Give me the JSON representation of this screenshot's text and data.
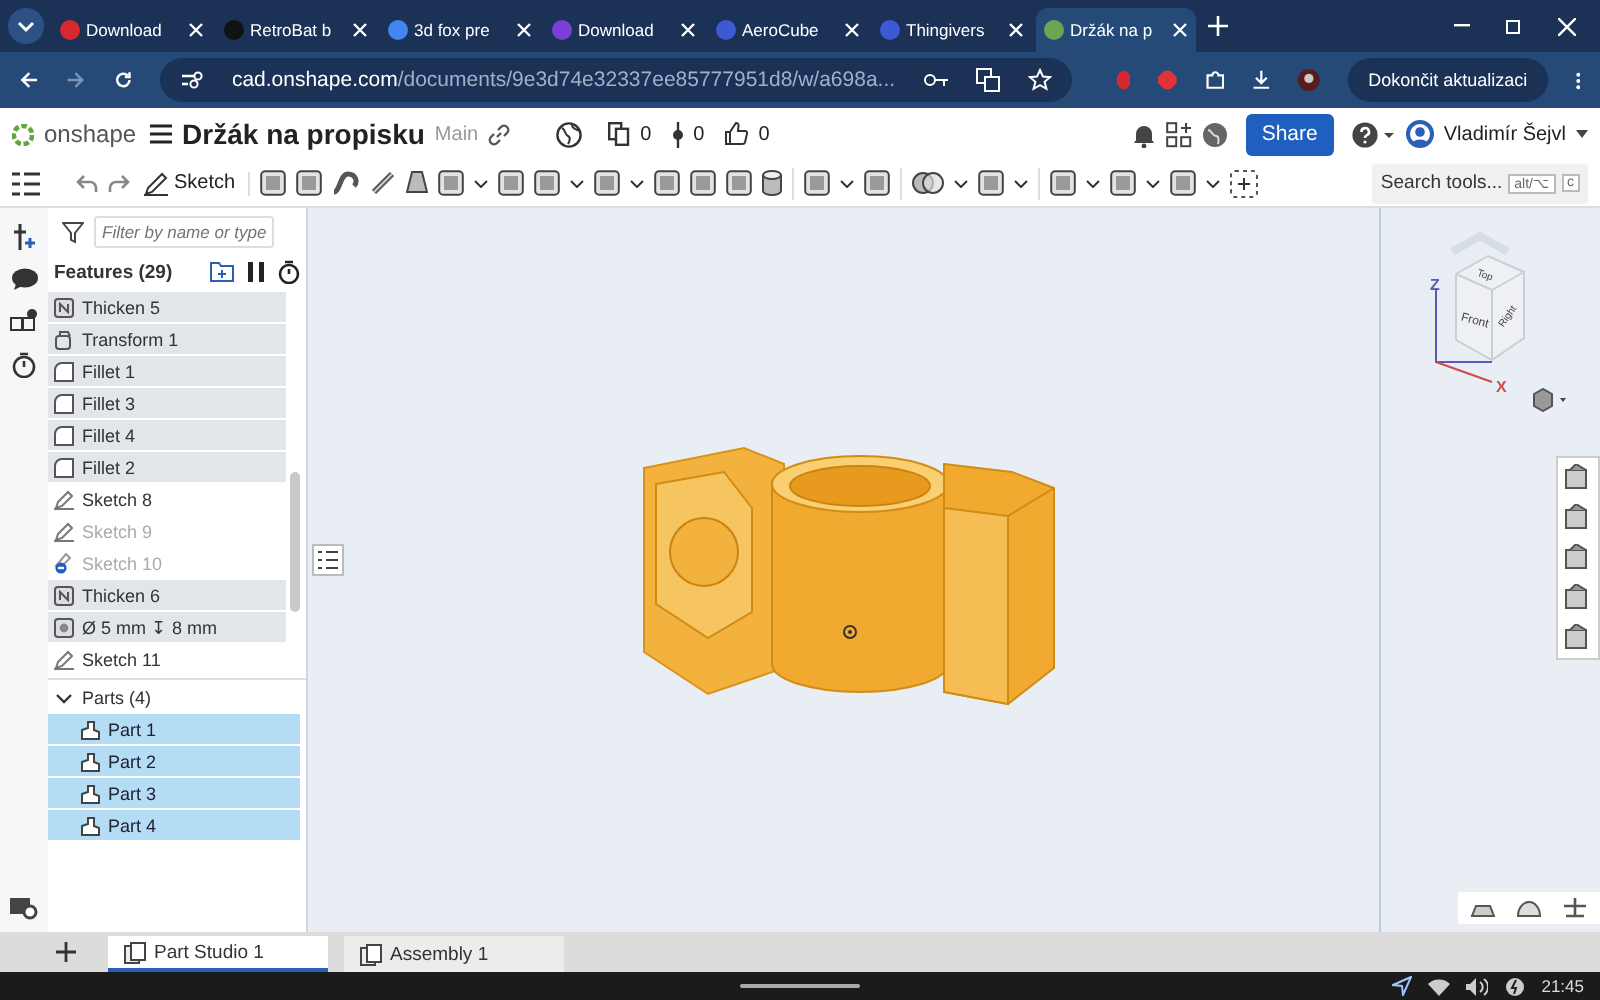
{
  "browser": {
    "tabs": [
      {
        "title": "Download",
        "selected": false,
        "color": "#d8282f"
      },
      {
        "title": "RetroBat b",
        "selected": false,
        "color": "#111111"
      },
      {
        "title": "3d fox pre",
        "selected": false,
        "color": "#4285f4"
      },
      {
        "title": "Download",
        "selected": false,
        "color": "#7b3fd6"
      },
      {
        "title": "AeroCube",
        "selected": false,
        "color": "#3c5ad6"
      },
      {
        "title": "Thingivers",
        "selected": false,
        "color": "#3c5ad6"
      },
      {
        "title": "Držák na p",
        "selected": true,
        "color": "#6aa84f"
      }
    ],
    "url_host": "cad.onshape.com",
    "url_path": "/documents/9e3d74e32337ee85777951d8/w/a698a...",
    "update_button": "Dokončit aktualizaci"
  },
  "header": {
    "brand": "onshape",
    "document_title": "Držák na propisku",
    "branch": "Main",
    "counts": [
      "0",
      "0",
      "0"
    ],
    "share": "Share",
    "user": "Vladimír Šejvl"
  },
  "toolbar": {
    "sketch": "Sketch",
    "search": "Search tools...",
    "shortcut": [
      "alt/⌥",
      "c"
    ]
  },
  "features": {
    "filter_placeholder": "Filter by name or type",
    "heading": "Features (29)",
    "items": [
      {
        "name": "Thicken 5",
        "kind": "thicken",
        "dimmed": false
      },
      {
        "name": "Transform 1",
        "kind": "transform",
        "dimmed": false
      },
      {
        "name": "Fillet 1",
        "kind": "fillet",
        "dimmed": false
      },
      {
        "name": "Fillet 3",
        "kind": "fillet",
        "dimmed": false
      },
      {
        "name": "Fillet 4",
        "kind": "fillet",
        "dimmed": false
      },
      {
        "name": "Fillet 2",
        "kind": "fillet",
        "dimmed": false
      },
      {
        "name": "Sketch 8",
        "kind": "sketch",
        "dimmed": false
      },
      {
        "name": "Sketch 9",
        "kind": "sketch",
        "dimmed": true
      },
      {
        "name": "Sketch 10",
        "kind": "sketch-flagged",
        "dimmed": true
      },
      {
        "name": "Thicken 6",
        "kind": "thicken",
        "dimmed": false
      },
      {
        "name": "Ø 5 mm ↧ 8 mm",
        "kind": "hole",
        "dimmed": false
      },
      {
        "name": "Sketch 11",
        "kind": "sketch",
        "dimmed": false
      }
    ],
    "parts_heading": "Parts (4)",
    "parts": [
      {
        "name": "Part 1",
        "selected": true
      },
      {
        "name": "Part 2",
        "selected": true
      },
      {
        "name": "Part 3",
        "selected": true
      },
      {
        "name": "Part 4",
        "selected": true
      }
    ]
  },
  "view_cube": {
    "faces": [
      "Top",
      "Front",
      "Right"
    ],
    "axes": [
      "Z",
      "X"
    ]
  },
  "bottom_tabs": [
    {
      "label": "Part Studio 1",
      "selected": true
    },
    {
      "label": "Assembly 1",
      "selected": false
    }
  ],
  "status_bar": {
    "time": "21:45"
  }
}
